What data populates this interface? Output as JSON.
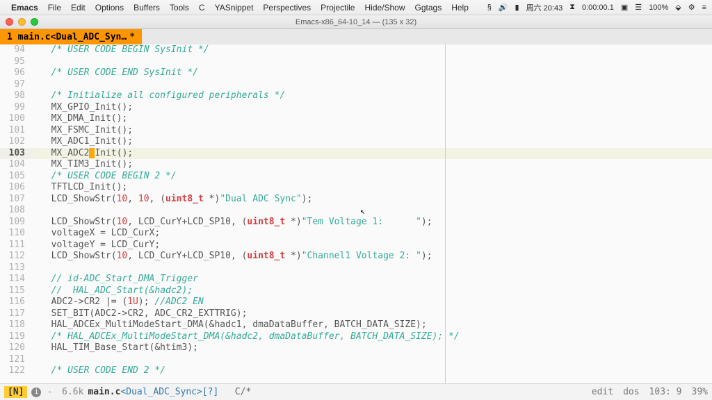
{
  "menubar": {
    "apple": "",
    "app": "Emacs",
    "items": [
      "File",
      "Edit",
      "Options",
      "Buffers",
      "Tools",
      "C",
      "YASnippet",
      "Perspectives",
      "Projectile",
      "Hide/Show",
      "Ggtags",
      "Help"
    ],
    "status_time": "周六 20:43",
    "status_timer": "0:00:00.1",
    "battery": "100%"
  },
  "titlebar": {
    "title": "Emacs-x86_64-10_14 — (135 x 32)"
  },
  "tab": {
    "index": "1",
    "name": "main.c<Dual_ADC_Syn…",
    "dirty": "*"
  },
  "lines": [
    {
      "n": 94,
      "kind": "comment",
      "indent": "  ",
      "text": "/* USER CODE BEGIN SysInit */"
    },
    {
      "n": 95,
      "kind": "blank",
      "indent": "",
      "text": ""
    },
    {
      "n": 96,
      "kind": "comment",
      "indent": "  ",
      "text": "/* USER CODE END SysInit */"
    },
    {
      "n": 97,
      "kind": "blank",
      "indent": "",
      "text": ""
    },
    {
      "n": 98,
      "kind": "comment",
      "indent": "  ",
      "text": "/* Initialize all configured peripherals */"
    },
    {
      "n": 99,
      "kind": "plain",
      "indent": "  ",
      "text": "MX_GPIO_Init();"
    },
    {
      "n": 100,
      "kind": "plain",
      "indent": "  ",
      "text": "MX_DMA_Init();"
    },
    {
      "n": 101,
      "kind": "plain",
      "indent": "  ",
      "text": "MX_FSMC_Init();"
    },
    {
      "n": 102,
      "kind": "plain",
      "indent": "  ",
      "text": "MX_ADC1_Init();"
    },
    {
      "n": 103,
      "kind": "cursor",
      "indent": "  ",
      "pre": "MX_ADC2",
      "post": "Init();"
    },
    {
      "n": 104,
      "kind": "plain",
      "indent": "  ",
      "text": "MX_TIM3_Init();"
    },
    {
      "n": 105,
      "kind": "comment",
      "indent": "  ",
      "text": "/* USER CODE BEGIN 2 */"
    },
    {
      "n": 106,
      "kind": "plain",
      "indent": "  ",
      "text": "TFTLCD_Init();"
    },
    {
      "n": 107,
      "kind": "call1",
      "indent": "  ",
      "pre": "LCD_ShowStr(",
      "a1": "10",
      "a2": "10",
      "castpre": ", (",
      "type": "uint8_t",
      "castpost": " *)",
      "str": "\"Dual ADC Sync\"",
      "post": ");"
    },
    {
      "n": 108,
      "kind": "blank",
      "indent": "",
      "text": ""
    },
    {
      "n": 109,
      "kind": "call2",
      "indent": "  ",
      "pre": "LCD_ShowStr(",
      "a1": "10",
      "mid": ", LCD_CurY+LCD_SP10, (",
      "type": "uint8_t",
      "castpost": " *)",
      "str": "\"Tem Voltage 1:      \"",
      "post": ");"
    },
    {
      "n": 110,
      "kind": "plain",
      "indent": "  ",
      "text": "voltageX = LCD_CurX;"
    },
    {
      "n": 111,
      "kind": "plain",
      "indent": "  ",
      "text": "voltageY = LCD_CurY;"
    },
    {
      "n": 112,
      "kind": "call2",
      "indent": "  ",
      "pre": "LCD_ShowStr(",
      "a1": "10",
      "mid": ", LCD_CurY+LCD_SP10, (",
      "type": "uint8_t",
      "castpost": " *)",
      "str": "\"Channel1 Voltage 2: \"",
      "post": ");"
    },
    {
      "n": 113,
      "kind": "blank",
      "indent": "",
      "text": ""
    },
    {
      "n": 114,
      "kind": "comment",
      "indent": "  ",
      "text": "// id-ADC_Start_DMA_Trigger"
    },
    {
      "n": 115,
      "kind": "comment",
      "indent": "  ",
      "text": "//  HAL_ADC_Start(&hadc2);"
    },
    {
      "n": 116,
      "kind": "mixed",
      "indent": "  ",
      "pre": "ADC2->CR2 |= (",
      "num": "1U",
      "mid": "); ",
      "comment": "//ADC2 EN"
    },
    {
      "n": 117,
      "kind": "plain",
      "indent": "  ",
      "text": "SET_BIT(ADC2->CR2, ADC_CR2_EXTTRIG);"
    },
    {
      "n": 118,
      "kind": "plain",
      "indent": "  ",
      "text": "HAL_ADCEx_MultiModeStart_DMA(&hadc1, dmaDataBuffer, BATCH_DATA_SIZE);"
    },
    {
      "n": 119,
      "kind": "comment",
      "indent": "  ",
      "text": "/* HAL_ADCEx_MultiModeStart_DMA(&hadc2, dmaDataBuffer, BATCH_DATA_SIZE); */"
    },
    {
      "n": 120,
      "kind": "plain",
      "indent": "  ",
      "text": "HAL_TIM_Base_Start(&htim3);"
    },
    {
      "n": 121,
      "kind": "blank",
      "indent": "",
      "text": ""
    },
    {
      "n": 122,
      "kind": "comment",
      "indent": "  ",
      "text": "/* USER CODE END 2 */"
    }
  ],
  "current_line": 103,
  "modeline": {
    "state": "[N]",
    "dash": "-",
    "size": "6.6k",
    "fname": "main.c",
    "proj": "<Dual_ADC_Sync>",
    "vcs": "[?]",
    "mode": "C/*",
    "edit": "edit",
    "eol": "dos",
    "pos": "103: 9",
    "pct": "39%"
  }
}
